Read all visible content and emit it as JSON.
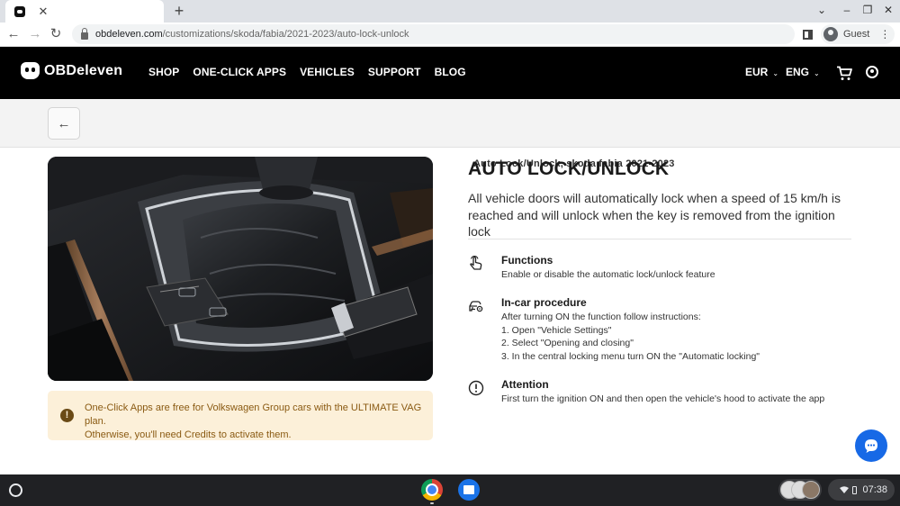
{
  "browser": {
    "tab_title": "Auto Lock/Unlock, skoda fabia 2021-2023",
    "url_host": "obdeleven.com",
    "url_path": "/customizations/skoda/fabia/2021-2023/auto-lock-unlock",
    "profile_label": "Guest"
  },
  "header": {
    "brand": "OBDeleven",
    "nav": [
      "SHOP",
      "ONE-CLICK APPS",
      "VEHICLES",
      "SUPPORT",
      "BLOG"
    ],
    "currency": "EUR",
    "language": "ENG"
  },
  "feature": {
    "title": "AUTO LOCK/UNLOCK",
    "description": "All vehicle doors will automatically lock when a speed of 15 km/h is reached and will unlock when the key is removed from the ignition lock",
    "sections": [
      {
        "icon": "hand-pointer-icon",
        "heading": "Functions",
        "lines": [
          "Enable or disable the automatic lock/unlock feature"
        ]
      },
      {
        "icon": "car-settings-icon",
        "heading": "In-car procedure",
        "lines": [
          "After turning ON the function follow instructions:",
          "1. Open \"Vehicle Settings\"",
          "2. Select \"Opening and closing\"",
          "3. In the central locking menu turn ON the \"Automatic locking\""
        ]
      },
      {
        "icon": "alert-circle-icon",
        "heading": "Attention",
        "lines": [
          "First turn the ignition ON and then open the vehicle's hood to activate the app"
        ]
      }
    ]
  },
  "notice": {
    "line1": "One-Click Apps are free for Volkswagen Group cars with the ULTIMATE VAG plan.",
    "line2": "Otherwise, you'll need Credits to activate them."
  },
  "shelf": {
    "clock": "07:38"
  }
}
